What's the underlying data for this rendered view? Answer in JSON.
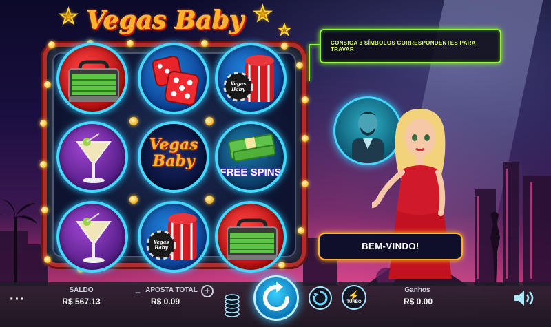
{
  "game": {
    "logo_text": "Vegas Baby",
    "message": "CONSIGA 3 SÍMBOLOS CORRESPONDENTES PARA TRAVAR",
    "welcome": "BEM-VINDO!"
  },
  "reels": {
    "symbols": [
      [
        "money-briefcase",
        "dice",
        "poker-chips"
      ],
      [
        "martini",
        "vegas-baby-logo",
        "free-spins-cash"
      ],
      [
        "martini",
        "poker-chips",
        "money-briefcase"
      ]
    ],
    "logo_symbol_text": "Vegas Baby",
    "free_spins_text": "FREE SPINS",
    "chip_text": "Vegas Baby"
  },
  "bar": {
    "menu_glyph": "···",
    "saldo_label": "SALDO",
    "saldo_value": "R$ 567.13",
    "aposta_label": "APOSTA TOTAL",
    "aposta_value": "R$ 0.09",
    "minus_glyph": "−",
    "plus_glyph": "+",
    "turbo_label": "TURBO",
    "ganhos_label": "Ganhos",
    "ganhos_value": "R$ 0.00"
  },
  "colors": {
    "neon_cyan": "#45d8ff",
    "neon_green": "#8dff2a",
    "gold": "#ffb12a",
    "frame_red": "#b02d2b"
  }
}
